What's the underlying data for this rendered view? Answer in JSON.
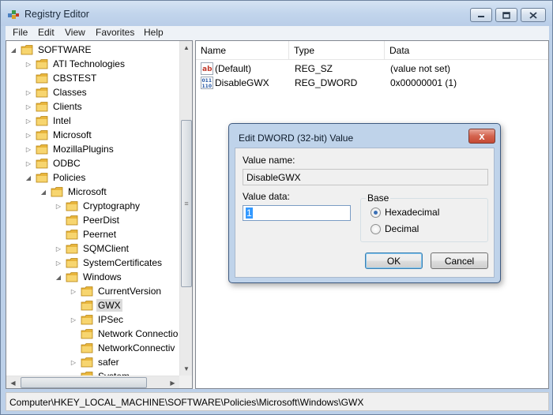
{
  "window": {
    "title": "Registry Editor"
  },
  "menu": [
    "File",
    "Edit",
    "View",
    "Favorites",
    "Help"
  ],
  "tree": [
    {
      "label": "SOFTWARE",
      "level": 0,
      "expander": "open"
    },
    {
      "label": "ATI Technologies",
      "level": 1,
      "expander": "closed"
    },
    {
      "label": "CBSTEST",
      "level": 1,
      "expander": "none"
    },
    {
      "label": "Classes",
      "level": 1,
      "expander": "closed"
    },
    {
      "label": "Clients",
      "level": 1,
      "expander": "closed"
    },
    {
      "label": "Intel",
      "level": 1,
      "expander": "closed"
    },
    {
      "label": "Microsoft",
      "level": 1,
      "expander": "closed"
    },
    {
      "label": "MozillaPlugins",
      "level": 1,
      "expander": "closed"
    },
    {
      "label": "ODBC",
      "level": 1,
      "expander": "closed"
    },
    {
      "label": "Policies",
      "level": 1,
      "expander": "open"
    },
    {
      "label": "Microsoft",
      "level": 2,
      "expander": "open"
    },
    {
      "label": "Cryptography",
      "level": 3,
      "expander": "closed"
    },
    {
      "label": "PeerDist",
      "level": 3,
      "expander": "none"
    },
    {
      "label": "Peernet",
      "level": 3,
      "expander": "none"
    },
    {
      "label": "SQMClient",
      "level": 3,
      "expander": "closed"
    },
    {
      "label": "SystemCertificates",
      "level": 3,
      "expander": "closed"
    },
    {
      "label": "Windows",
      "level": 3,
      "expander": "open"
    },
    {
      "label": "CurrentVersion",
      "level": 4,
      "expander": "closed"
    },
    {
      "label": "GWX",
      "level": 4,
      "expander": "none",
      "selected": true
    },
    {
      "label": "IPSec",
      "level": 4,
      "expander": "closed"
    },
    {
      "label": "Network Connectio",
      "level": 4,
      "expander": "none"
    },
    {
      "label": "NetworkConnectiv",
      "level": 4,
      "expander": "none"
    },
    {
      "label": "safer",
      "level": 4,
      "expander": "closed"
    },
    {
      "label": "System",
      "level": 4,
      "expander": "none"
    }
  ],
  "list": {
    "columns": [
      "Name",
      "Type",
      "Data"
    ],
    "rows": [
      {
        "name": "(Default)",
        "type": "REG_SZ",
        "data": "(value not set)",
        "icon": "string-value-icon"
      },
      {
        "name": "DisableGWX",
        "type": "REG_DWORD",
        "data": "0x00000001 (1)",
        "icon": "dword-value-icon"
      }
    ]
  },
  "status": {
    "path": "Computer\\HKEY_LOCAL_MACHINE\\SOFTWARE\\Policies\\Microsoft\\Windows\\GWX"
  },
  "dialog": {
    "title": "Edit DWORD (32-bit) Value",
    "value_name_label": "Value name:",
    "value_name": "DisableGWX",
    "value_data_label": "Value data:",
    "value_data": "1",
    "base_label": "Base",
    "radio_hex": "Hexadecimal",
    "radio_dec": "Decimal",
    "selected_base": "Hexadecimal",
    "ok_label": "OK",
    "cancel_label": "Cancel",
    "close_glyph": "x"
  }
}
